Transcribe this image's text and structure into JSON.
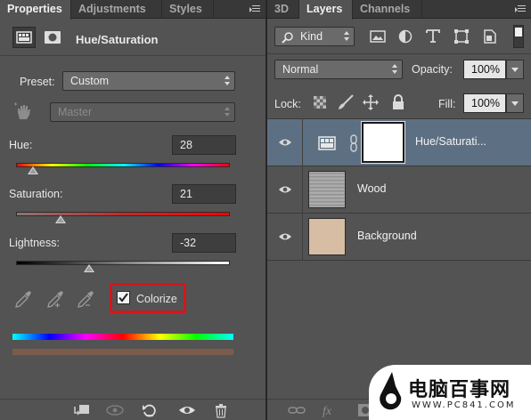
{
  "left_panel": {
    "tabs": [
      {
        "label": "Properties",
        "active": true
      },
      {
        "label": "Adjustments",
        "active": false
      },
      {
        "label": "Styles",
        "active": false
      }
    ],
    "title": "Hue/Saturation",
    "preset_label": "Preset:",
    "preset_value": "Custom",
    "channel_value": "Master",
    "hue_label": "Hue:",
    "hue_value": "28",
    "hue_level": 28,
    "saturation_label": "Saturation:",
    "saturation_value": "21",
    "saturation_level": 21,
    "lightness_label": "Lightness:",
    "lightness_value": "-32",
    "lightness_level": -32,
    "colorize_label": "Colorize",
    "colorize_checked": true,
    "highlight_color": "#d3161b"
  },
  "right_panel": {
    "tabs": [
      {
        "label": "3D",
        "active": false
      },
      {
        "label": "Layers",
        "active": true
      },
      {
        "label": "Channels",
        "active": false
      }
    ],
    "filter_value": "Kind",
    "blend_mode": "Normal",
    "opacity_label": "Opacity:",
    "opacity_value": "100%",
    "lock_label": "Lock:",
    "fill_label": "Fill:",
    "fill_value": "100%",
    "layers": [
      {
        "name": "Hue/Saturati...",
        "type": "adjustment",
        "selected": true
      },
      {
        "name": "Wood",
        "type": "image",
        "selected": false
      },
      {
        "name": "Background",
        "type": "fill",
        "color": "#d6bda3",
        "selected": false
      }
    ]
  },
  "watermark": {
    "title": "电脑百事网",
    "url": "WWW.PC841.COM"
  },
  "icons": [
    "adjustment-icon",
    "mask-icon",
    "target-adjust-icon",
    "eyedropper-icon",
    "eyedropper-plus-icon",
    "eyedropper-minus-icon",
    "search-icon",
    "image-filter-icon",
    "adjustment-filter-icon",
    "type-filter-icon",
    "shape-filter-icon",
    "smartobject-filter-icon",
    "filter-toggle-icon",
    "lock-transparent-icon",
    "lock-paint-icon",
    "lock-move-icon",
    "lock-all-icon",
    "eye-icon",
    "chain-icon",
    "clip-icon",
    "view-previous-icon",
    "reset-icon",
    "visibility-icon",
    "trash-icon",
    "link-icon",
    "fx-icon",
    "add-mask-icon",
    "new-adjustment-icon",
    "group-icon",
    "new-layer-icon"
  ]
}
